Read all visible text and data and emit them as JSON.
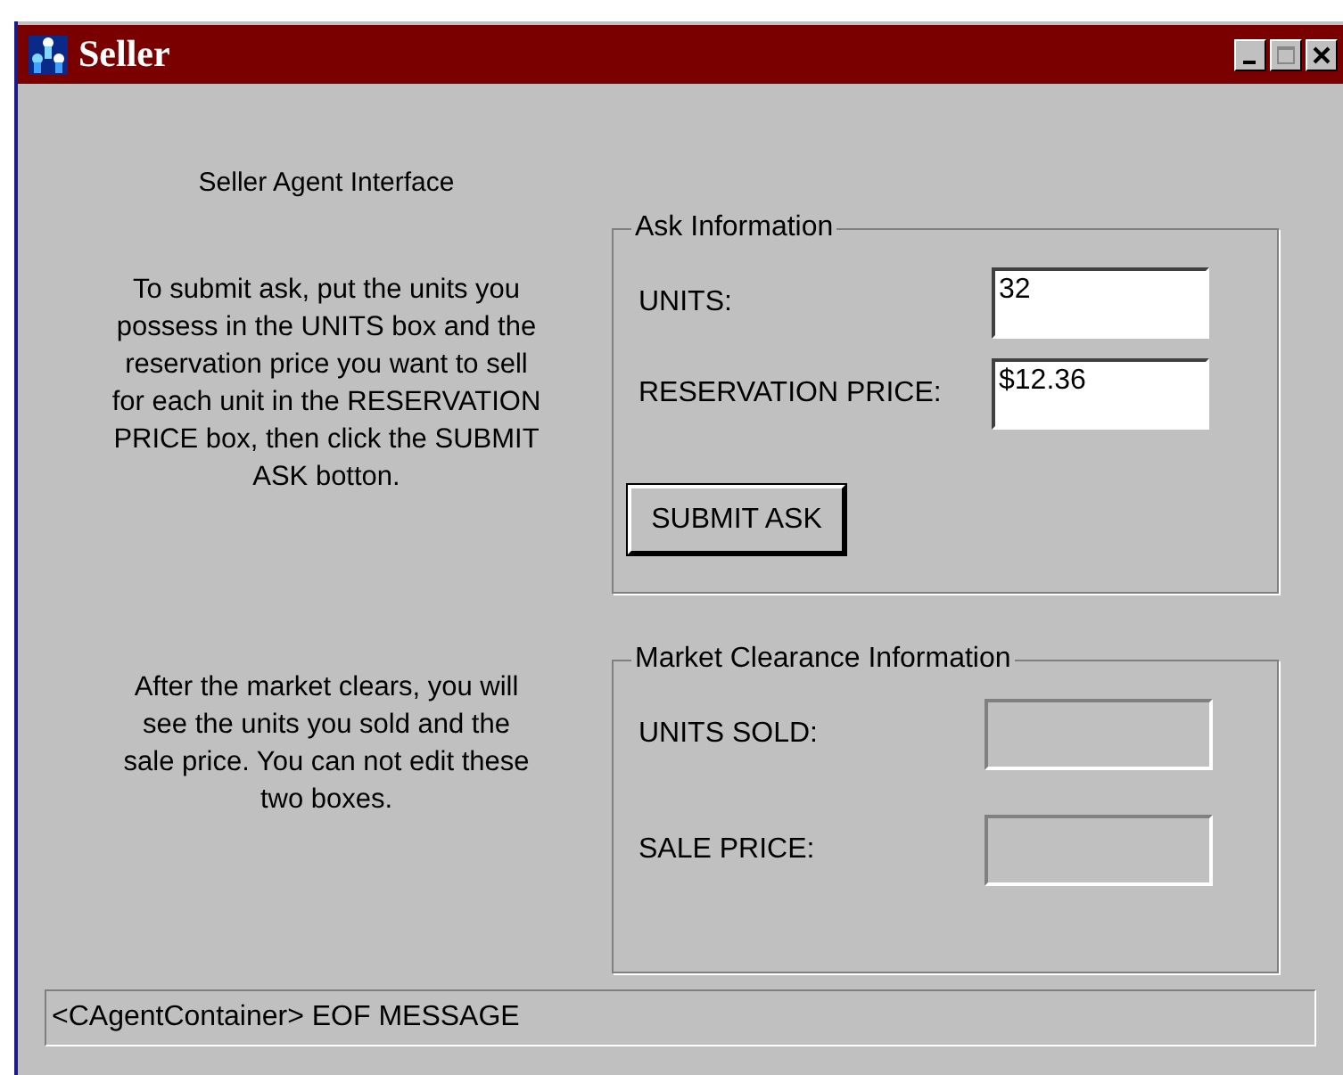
{
  "window": {
    "title": "Seller"
  },
  "intro": {
    "heading": "Seller Agent Interface",
    "instructions": "To submit ask, put the units you possess in the UNITS box and the reservation price you want to sell for each unit in the RESERVATION PRICE box, then click the SUBMIT ASK botton.",
    "clearance_note": "After the market clears, you will see the units you sold and the sale price. You can not edit these two boxes."
  },
  "ask_group": {
    "title": "Ask Information",
    "fields": [
      {
        "label": "UNITS:",
        "value": "32",
        "disabled": false
      },
      {
        "label": "RESERVATION PRICE:",
        "value": "$12.36",
        "disabled": false
      }
    ],
    "button": "SUBMIT ASK"
  },
  "clearance_group": {
    "title": "Market Clearance Information",
    "fields": [
      {
        "label": "UNITS SOLD:",
        "disabled": true
      },
      {
        "label": "SALE PRICE:",
        "disabled": true
      }
    ]
  },
  "status_bar": "<CAgentContainer> EOF MESSAGE"
}
